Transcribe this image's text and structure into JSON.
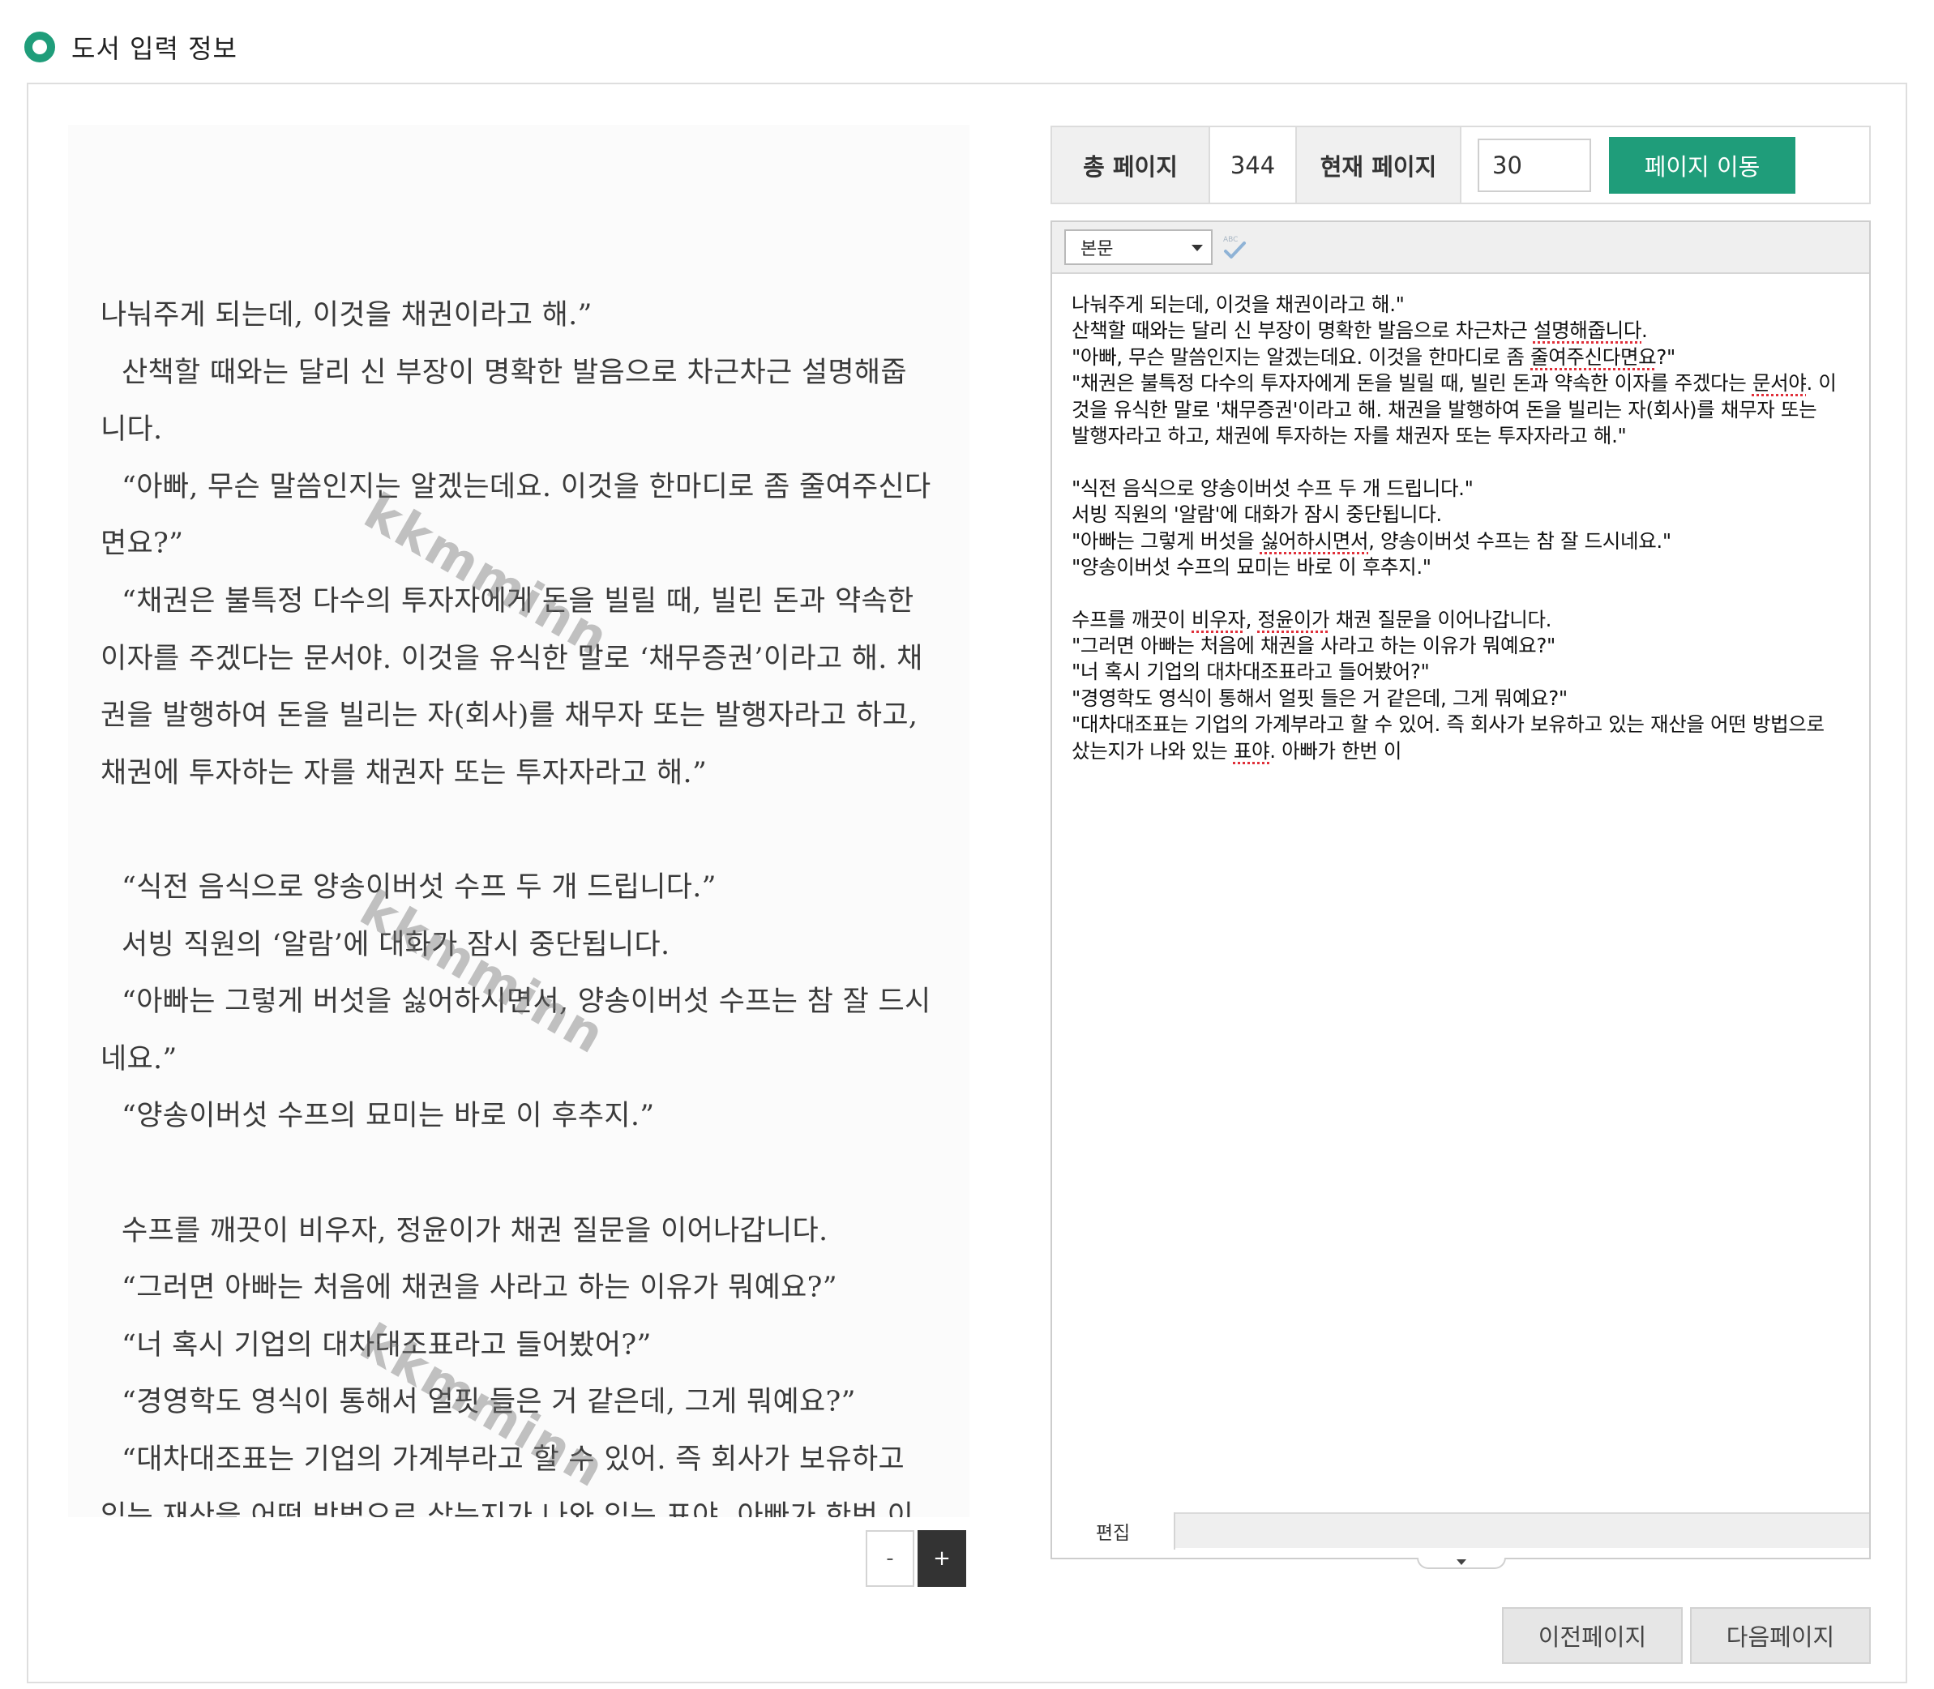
{
  "header": {
    "title": "도서 입력 정보"
  },
  "scan": {
    "lines": [
      {
        "text": "나눠주게 되는데, 이것을 채권이라고 해.”",
        "indent": false,
        "justify": false
      },
      {
        "text": "산책할 때와는 달리 신 부장이 명확한 발음으로 차근차근 설명해줍",
        "indent": true,
        "justify": false
      },
      {
        "text": "니다.",
        "indent": false,
        "justify": false
      },
      {
        "text": "“아빠, 무슨 말씀인지는 알겠는데요. 이것을 한마디로 좀 줄여주신다",
        "indent": true,
        "justify": false
      },
      {
        "text": "면요?”",
        "indent": false,
        "justify": false
      },
      {
        "text": "“채권은 불특정 다수의 투자자에게 돈을 빌릴 때, 빌린 돈과 약속한",
        "indent": true,
        "justify": false
      },
      {
        "text": "이자를 주겠다는 문서야. 이것을 유식한 말로 ‘채무증권’이라고 해. 채",
        "indent": false,
        "justify": false
      },
      {
        "text": "권을 발행하여 돈을 빌리는 자(회사)를 채무자 또는 발행자라고 하고,",
        "indent": false,
        "justify": false
      },
      {
        "text": "채권에 투자하는 자를 채권자 또는 투자자라고 해.”",
        "indent": false,
        "justify": false
      },
      {
        "text": "",
        "indent": false,
        "justify": false
      },
      {
        "text": "“식전 음식으로 양송이버섯 수프 두 개 드립니다.”",
        "indent": true,
        "justify": false
      },
      {
        "text": "서빙 직원의 ‘알람’에 대화가 잠시 중단됩니다.",
        "indent": true,
        "justify": false
      },
      {
        "text": "“아빠는 그렇게 버섯을 싫어하시면서, 양송이버섯 수프는 참 잘 드시",
        "indent": true,
        "justify": false
      },
      {
        "text": "네요.”",
        "indent": false,
        "justify": false
      },
      {
        "text": "“양송이버섯 수프의 묘미는 바로 이 후추지.”",
        "indent": true,
        "justify": false
      },
      {
        "text": "",
        "indent": false,
        "justify": false
      },
      {
        "text": "수프를 깨끗이 비우자, 정윤이가 채권 질문을 이어나갑니다.",
        "indent": true,
        "justify": false
      },
      {
        "text": "“그러면 아빠는 처음에 채권을 사라고 하는 이유가 뭐예요?”",
        "indent": true,
        "justify": false
      },
      {
        "text": "“너 혹시 기업의 대차대조표라고 들어봤어?”",
        "indent": true,
        "justify": false
      },
      {
        "text": "“경영학도 영식이 통해서 얼핏 들은 거 같은데, 그게 뭐예요?”",
        "indent": true,
        "justify": false
      },
      {
        "text": "“대차대조표는 기업의 가계부라고 할 수 있어. 즉 회사가 보유하고",
        "indent": true,
        "justify": false
      },
      {
        "text": "있는 재산을 어떤 방법으로 샀는지가 나와 있는 표야. 아빠가 한번 이",
        "indent": false,
        "justify": false
      }
    ],
    "watermark": "kkmminn",
    "zoom_out_label": "-",
    "zoom_in_label": "+"
  },
  "page_info": {
    "total_label": "총 페이지",
    "total_value": "344",
    "current_label": "현재 페이지",
    "current_value": "30",
    "go_button": "페이지 이동"
  },
  "editor": {
    "format_select": "본문",
    "spellcheck_icon": "spellcheck-icon",
    "mode_tab": "편집",
    "lines": [
      [
        {
          "t": "나눠주게 되는데, 이것을 채권이라고 해.\""
        }
      ],
      [
        {
          "t": "산책할 때와는 달리 신 부장이 명확한 발음으로 차근차근 "
        },
        {
          "t": "설명해줍니다",
          "s": true
        },
        {
          "t": "."
        }
      ],
      [
        {
          "t": "\"아빠, 무슨 말씀인지는 알겠는데요. 이것을 한마디로 좀 "
        },
        {
          "t": "줄여주신다면요",
          "s": true
        },
        {
          "t": "?\""
        }
      ],
      [
        {
          "t": "\"채권은 불특정 다수의 투자자에게 돈을 빌릴 때, 빌린 돈과 약속한 이자를 주겠다는 "
        },
        {
          "t": "문서야",
          "s": true
        },
        {
          "t": ". 이"
        }
      ],
      [
        {
          "t": "것을 유식한 말로 '채무증권'이라고 해. 채권을 발행하여 돈을 빌리는 자(회사)를 채무자 또는"
        }
      ],
      [
        {
          "t": "발행자라고 하고, 채권에 투자하는 자를 채권자 또는 투자자라고 해.\""
        }
      ],
      [
        {
          "t": ""
        }
      ],
      [
        {
          "t": "\"식전 음식으로 양송이버섯 수프 두 개 드립니다.\""
        }
      ],
      [
        {
          "t": "서빙 직원의 '알람'에 대화가 잠시 중단됩니다."
        }
      ],
      [
        {
          "t": "\"아빠는 그렇게 버섯을 "
        },
        {
          "t": "싫어하시면서",
          "s": true
        },
        {
          "t": ", 양송이버섯 수프는 참 잘 드시네요.\""
        }
      ],
      [
        {
          "t": "\"양송이버섯 수프의 묘미는 바로 이 후추지.\""
        }
      ],
      [
        {
          "t": ""
        }
      ],
      [
        {
          "t": "수프를 깨끗이 "
        },
        {
          "t": "비우자",
          "s": true
        },
        {
          "t": ", "
        },
        {
          "t": "정윤이가",
          "s": true
        },
        {
          "t": " 채권 질문을 이어나갑니다."
        }
      ],
      [
        {
          "t": "\"그러면 아빠는 처음에 채권을 사라고 하는 이유가 뭐예요?\""
        }
      ],
      [
        {
          "t": "\"너 혹시 기업의 대차대조표라고 들어봤어?\""
        }
      ],
      [
        {
          "t": "\"경영학도 영식이 통해서 얼핏 들은 거 같은데, 그게 뭐예요?\""
        }
      ],
      [
        {
          "t": "\"대차대조표는 기업의 가계부라고 할 수 있어. 즉 회사가 보유하고 있는 재산을 어떤 방법으로"
        }
      ],
      [
        {
          "t": "샀는지가 나와 있는 "
        },
        {
          "t": "표야",
          "s": true
        },
        {
          "t": ". 아빠가 한번 이"
        }
      ]
    ]
  },
  "nav": {
    "prev": "이전페이지",
    "next": "다음페이지"
  },
  "colors": {
    "accent": "#1f9d7a",
    "spell_underline": "#e0303a"
  }
}
